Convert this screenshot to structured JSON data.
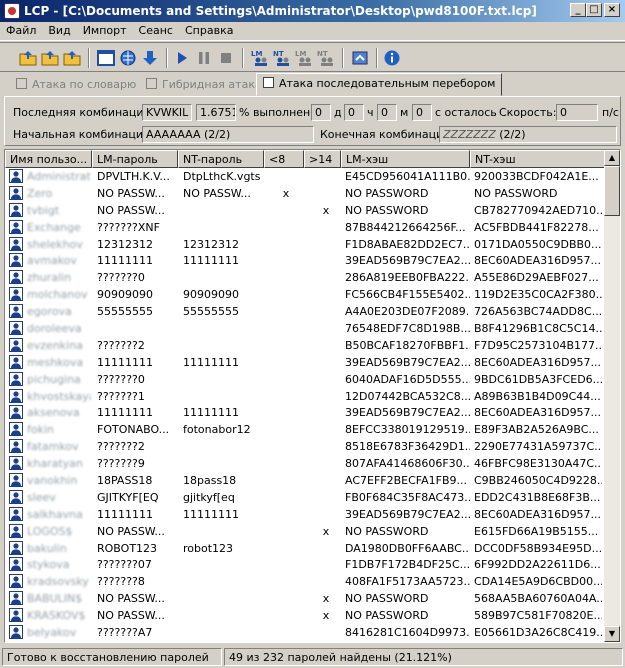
{
  "window": {
    "title": "LCP - [C:\\Documents and Settings\\Administrator\\Desktop\\pwd8100F.txt.lcp]"
  },
  "menu": [
    "Файл",
    "Вид",
    "Импорт",
    "Сеанс",
    "Справка"
  ],
  "toolbar": {
    "icons": [
      "open-folder-icon",
      "open-folder-icon",
      "open-folder-icon",
      "save-icon",
      "window-icon",
      "globe-icon",
      "download-icon",
      "play-icon",
      "pause-icon",
      "stop-icon",
      "lm-users-icon",
      "nt-users-icon",
      "lm-users-icon",
      "nt-users-icon",
      "export-icon",
      "info-icon"
    ]
  },
  "tabs": [
    {
      "label": "Атака по словарю",
      "active": false
    },
    {
      "label": "Гибридная атака",
      "active": false
    },
    {
      "label": "Атака последовательным перебором",
      "active": true
    }
  ],
  "progress": {
    "last_combo_label": "Последняя комбинация:",
    "last_combo": "KVWKIL",
    "percent": "1.6751",
    "percent_label": "% выполнено",
    "days": "0",
    "d_label": "д",
    "hours": "0",
    "h_label": "ч",
    "minutes": "0",
    "m_label": "м",
    "seconds": "0",
    "s_label": "с осталось",
    "speed_label": "Скорость:",
    "speed": "0",
    "speed_unit": "п/с",
    "start_label": "Начальная комбинация:",
    "start": "AAAAAAA (2/2)",
    "end_label": "Конечная комбинация:",
    "end_value": "ZZZZZZZ",
    "end_suffix": "(2/2)"
  },
  "table": {
    "columns": [
      "Имя пользо...",
      "LM-пароль",
      "NT-пароль",
      "<8",
      ">14",
      "LM-хэш",
      "NT-хэш"
    ],
    "rows": [
      [
        "Administrator",
        "DPVLTH.K.V...",
        "DtpLthcK.vgts",
        "",
        "",
        "E45CD956041A111B0...",
        "920033BCDF042A1E..."
      ],
      [
        "Zero",
        "NO PASSW...",
        "NO PASSW...",
        "x",
        "",
        "NO PASSWORD",
        "NO PASSWORD"
      ],
      [
        "tvbigt",
        "NO PASSW...",
        "",
        "",
        "x",
        "NO PASSWORD",
        "CB782770942AED710..."
      ],
      [
        "Exchange",
        "???????XNF",
        "",
        "",
        "",
        "87B844212664256F...",
        "AC5FBDB441F82278..."
      ],
      [
        "shelekhov",
        "12312312",
        "12312312",
        "",
        "",
        "F1D8ABAE82DD2EC7...",
        "0171DA0550C9DBB0..."
      ],
      [
        "avmakov",
        "11111111",
        "11111111",
        "",
        "",
        "39EAD569B79C7EA2...",
        "8EC60ADEA316D957..."
      ],
      [
        "zhuralin",
        "???????0",
        "",
        "",
        "",
        "286A819EEB0FBA222...",
        "A55E86D29AEBF027..."
      ],
      [
        "molchanov",
        "90909090",
        "90909090",
        "",
        "",
        "FC566CB4F155E5402...",
        "119D2E35C0CA2F380..."
      ],
      [
        "egorova",
        "55555555",
        "55555555",
        "",
        "",
        "A4A0E203DE07F2089...",
        "726A563BC74ADD8C..."
      ],
      [
        "doroleeva",
        "",
        "",
        "",
        "",
        "76548EDF7C8D198B...",
        "B8F41296B1C8C5C14..."
      ],
      [
        "evzenkina",
        "???????2",
        "",
        "",
        "",
        "B50BCAF18270FBBF1...",
        "F7D95C2573104B177..."
      ],
      [
        "meshkova",
        "11111111",
        "11111111",
        "",
        "",
        "39EAD569B79C7EA2...",
        "8EC60ADEA316D957..."
      ],
      [
        "pichugina",
        "???????0",
        "",
        "",
        "",
        "6040ADAF16D5D555...",
        "9BDC61DB5A3FCED6..."
      ],
      [
        "khvostskaya",
        "???????1",
        "",
        "",
        "",
        "12D07442BCA532C8...",
        "A89B63B1B4D09C44..."
      ],
      [
        "aksenova",
        "11111111",
        "11111111",
        "",
        "",
        "39EAD569B79C7EA2...",
        "8EC60ADEA316D957..."
      ],
      [
        "fokin",
        "FOTONABO...",
        "fotonabor12",
        "",
        "",
        "8EFCC338019129519...",
        "E89F3AB2A526A9BC..."
      ],
      [
        "fatamkov",
        "???????2",
        "",
        "",
        "",
        "8518E6783F36429D1...",
        "2290E77431A59737C..."
      ],
      [
        "kharatyan",
        "???????9",
        "",
        "",
        "",
        "807AFA41468606F30...",
        "46FBFC98E3130A47C..."
      ],
      [
        "vanokhin",
        "18PASS18",
        "18pass18",
        "",
        "",
        "AC7EFF2BECFA1FB9...",
        "C9BB246050C4D9228..."
      ],
      [
        "sleev",
        "GJITKYF[EQ",
        "gjitkyf[eq",
        "",
        "",
        "FB0F684C35F8AC473...",
        "EDD2C431B8E68F3B..."
      ],
      [
        "salkhavna",
        "11111111",
        "11111111",
        "",
        "",
        "39EAD569B79C7EA2...",
        "8EC60ADEA316D957..."
      ],
      [
        "LOGOS$",
        "NO PASSW...",
        "",
        "",
        "x",
        "NO PASSWORD",
        "E615FD66A19B5155..."
      ],
      [
        "bakulin",
        "ROBOT123",
        "robot123",
        "",
        "",
        "DA1980DB0FF6AABC...",
        "DCC0DF58B934E95D..."
      ],
      [
        "stykova",
        "???????07",
        "",
        "",
        "",
        "F1DB7F172B4DF25C...",
        "6F992DD2A22611D6..."
      ],
      [
        "kradsovsky",
        "???????8",
        "",
        "",
        "",
        "408FA1F5173AA5723...",
        "CDA14E5A9D6CBD00..."
      ],
      [
        "BABULIN$",
        "NO PASSW...",
        "",
        "",
        "x",
        "NO PASSWORD",
        "568AA5BA60760A04A..."
      ],
      [
        "KRASKOV$",
        "NO PASSW...",
        "",
        "",
        "x",
        "NO PASSWORD",
        "589B97C581F70820E..."
      ],
      [
        "belyakov",
        "???????A7",
        "",
        "",
        "",
        "8416281C1604D9973...",
        "E05661D3A26C8C419..."
      ]
    ]
  },
  "status": {
    "left": "Готово к восстановлению паролей",
    "right": "49 из 232 паролей найдены (21.121%)"
  }
}
